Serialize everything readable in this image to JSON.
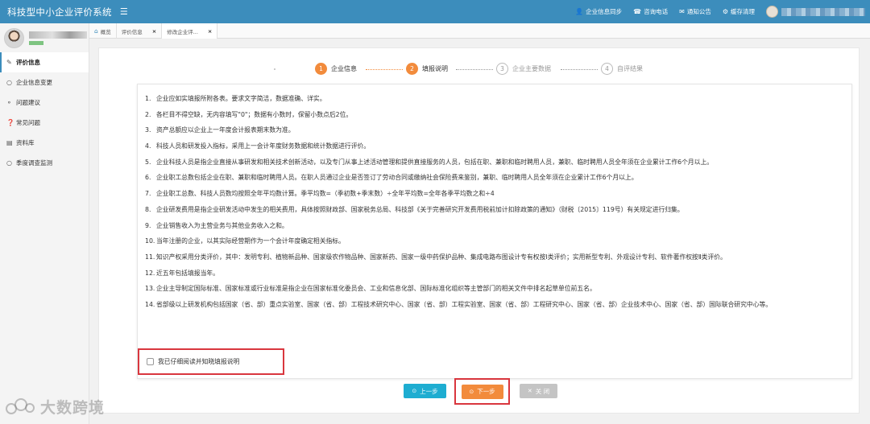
{
  "header": {
    "title": "科技型中小企业评价系统",
    "menu_icon": "hamburger-icon",
    "links": [
      {
        "label": "企业信息同步",
        "icon": "user-icon"
      },
      {
        "label": "咨询电话",
        "icon": "phone-icon"
      },
      {
        "label": "通知公告",
        "icon": "notice-icon"
      },
      {
        "label": "缓存清理",
        "icon": "gear-icon"
      }
    ]
  },
  "sidebar": {
    "items": [
      {
        "label": "评价信息",
        "icon": "edit-icon",
        "active": true
      },
      {
        "label": "企业信息变更",
        "icon": "circle-icon"
      },
      {
        "label": "问题建议",
        "icon": "comment-icon"
      },
      {
        "label": "常见问题",
        "icon": "question-icon"
      },
      {
        "label": "资料库",
        "icon": "folder-icon"
      },
      {
        "label": "季度调查监测",
        "icon": "circle-icon"
      }
    ]
  },
  "tabs": [
    {
      "label": "概览",
      "icon": "home-icon",
      "closable": false
    },
    {
      "label": "评价信息",
      "closable": true
    },
    {
      "label": "修改企业评...",
      "closable": true,
      "active": true
    }
  ],
  "steps": [
    {
      "num": "1",
      "label": "企业信息",
      "state": "done"
    },
    {
      "num": "2",
      "label": "填报说明",
      "state": "done"
    },
    {
      "num": "3",
      "label": "企业主要数据",
      "state": "pending"
    },
    {
      "num": "4",
      "label": "自评结果",
      "state": "pending"
    }
  ],
  "rules": [
    {
      "n": "1.",
      "text": "企业应如实填报所附各表。要求文字简洁，数据准确、详实。"
    },
    {
      "n": "2.",
      "text": "各栏目不得空缺，无内容填写\"0\"；数据有小数时，保留小数点后2位。"
    },
    {
      "n": "3.",
      "text": "资产总额应以企业上一年度会计报表期末数为准。"
    },
    {
      "n": "4.",
      "text": "科技人员和研发投入指标，采用上一会计年度财务数据和统计数据进行评价。"
    },
    {
      "n": "5.",
      "text": "企业科技人员是指企业直接从事研发和相关技术创新活动，以及专门从事上述活动管理和提供直接服务的人员，包括在职、兼职和临时聘用人员，兼职、临时聘用人员全年须在企业累计工作6个月以上。"
    },
    {
      "n": "6.",
      "text": "企业职工总数包括企业在职、兼职和临时聘用人员。在职人员通过企业是否签订了劳动合同或缴纳社会保险费来鉴别，兼职、临时聘用人员全年须在企业累计工作6个月以上。"
    },
    {
      "n": "7.",
      "text": "企业职工总数、科技人员数均按照全年平均数计算。季平均数=（季初数+季末数）÷全年平均数=全年各季平均数之和÷4"
    },
    {
      "n": "8.",
      "text": "企业研发费用是指企业研发活动中发生的相关费用，具体按照财政部、国家税务总局、科技部《关于完善研究开发费用税前加计扣除政策的通知》（财税〔2015〕119号）有关规定进行归集。"
    },
    {
      "n": "9.",
      "text": "企业销售收入为主营业务与其他业务收入之和。"
    },
    {
      "n": "10.",
      "text": "当年注册的企业，以其实际经营期作为一个会计年度确定相关指标。"
    },
    {
      "n": "11.",
      "text": "知识产权采用分类评价，其中：发明专利、植物新品种、国家级农作物品种、国家新药、国家一级中药保护品种、集成电路布图设计专有权按Ⅰ类评价；实用新型专利、外观设计专利、软件著作权按Ⅱ类评价。"
    },
    {
      "n": "12.",
      "text": "近五年包括填报当年。"
    },
    {
      "n": "13.",
      "text": "企业主导制定国际标准、国家标准或行业标准是指企业在国家标准化委员会、工业和信息化部、国际标准化组织等主管部门的相关文件中排名起草单位前五名。"
    },
    {
      "n": "14.",
      "text": "省部级以上研发机构包括国家（省、部）重点实验室、国家（省、部）工程技术研究中心、国家（省、部）工程实验室、国家（省、部）工程研究中心、国家（省、部）企业技术中心、国家（省、部）国际联合研究中心等。"
    }
  ],
  "agree_label": "我已仔细阅读并知晓填报说明",
  "buttons": {
    "prev": "上一步",
    "next": "下一步",
    "close": "关 闭"
  },
  "watermark": "大数跨境",
  "colors": {
    "primary": "#3c8dbc",
    "accent": "#f28b3c",
    "info": "#1eadd1",
    "highlight": "#d9363e"
  }
}
